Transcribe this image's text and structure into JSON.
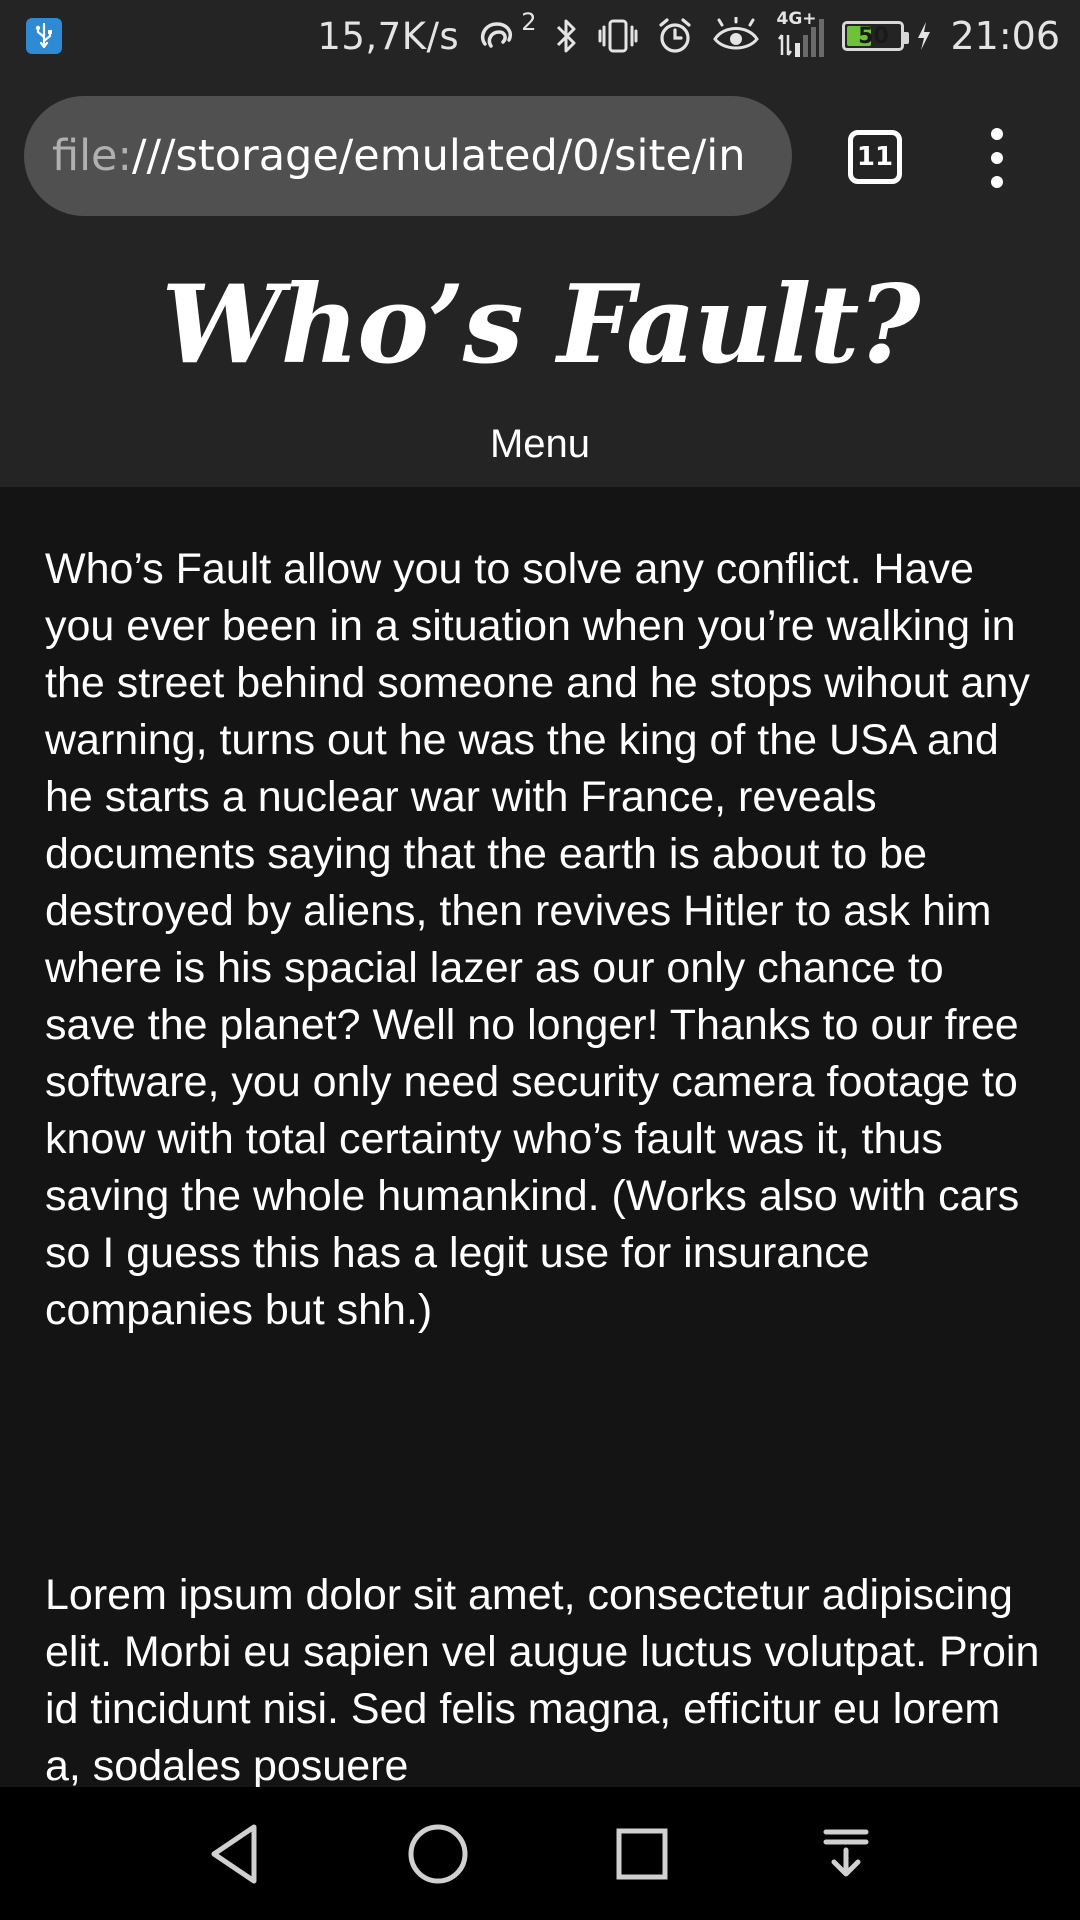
{
  "status_bar": {
    "net_speed": "15,7K/s",
    "hotspot_count": "2",
    "network_type": "4G+",
    "battery_percent": "50",
    "battery_level": 0.5,
    "time": "21:06",
    "colors": {
      "usb_badge": "#2f8ad6",
      "battery_fill": "#6ec23a"
    },
    "icons": [
      "usb-icon",
      "hotspot-icon",
      "bluetooth-icon",
      "vibrate-icon",
      "alarm-icon",
      "eye-comfort-icon",
      "signal-icon",
      "battery-icon",
      "charging-icon"
    ]
  },
  "browser": {
    "url_scheme": "file:",
    "url_rest": "///storage/emulated/0/site/in",
    "tab_count": "11",
    "icons": [
      "tab-switcher-icon",
      "overflow-menu-icon"
    ]
  },
  "site": {
    "title": "Who’s Fault?",
    "menu_label": "Menu",
    "paragraphs": [
      "Who’s Fault allow you to solve any conflict. Have you ever been in a situation when you’re walking in the street behind someone and he stops wihout any warning, turns out he was the king of the USA and he starts a nuclear war with France, reveals documents saying that the earth is about to be destroyed by aliens, then revives Hitler to ask him where is his spacial lazer as our only chance to save the planet? Well no longer! Thanks to our free software, you only need security camera footage to know with total certainty who’s fault was it, thus saving the whole humankind. (Works also with cars so I guess this has a legit use for insurance companies but shh.)",
      "Lorem ipsum dolor sit amet, consectetur adipiscing elit. Morbi eu sapien vel augue luctus volutpat. Proin id tincidunt nisi. Sed felis magna, efficitur eu lorem a, sodales posuere"
    ]
  },
  "nav_bar": {
    "icons": [
      "back-icon",
      "home-icon",
      "recents-icon",
      "notifications-pull-icon"
    ]
  }
}
